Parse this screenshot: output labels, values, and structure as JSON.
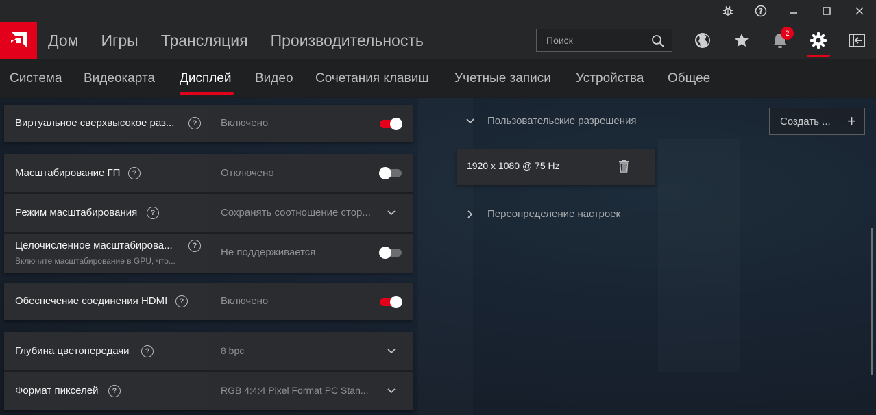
{
  "header": {
    "nav": [
      "Дом",
      "Игры",
      "Трансляция",
      "Производительность"
    ],
    "search_placeholder": "Поиск",
    "notification_count": "2"
  },
  "subnav": {
    "items": [
      "Система",
      "Видеокарта",
      "Дисплей",
      "Видео",
      "Сочетания клавиш",
      "Учетные записи",
      "Устройства",
      "Общее"
    ],
    "active": "Дисплей"
  },
  "settings": {
    "vsr": {
      "label": "Виртуальное сверхвысокое раз...",
      "value": "Включено",
      "enabled": true
    },
    "gpu_scaling": {
      "label": "Масштабирование ГП",
      "value": "Отключено",
      "enabled": false
    },
    "scaling_mode": {
      "label": "Режим масштабирования",
      "value": "Сохранять соотношение стор..."
    },
    "integer_scaling": {
      "label": "Целочисленное масштабирова...",
      "sublabel": "Включите масштабирование в GPU, что...",
      "value": "Не поддерживается",
      "enabled": false
    },
    "hdmi_link": {
      "label": "Обеспечение соединения HDMI",
      "value": "Включено",
      "enabled": true
    },
    "color_depth": {
      "label": "Глубина цветопередачи",
      "value": "8 bpc"
    },
    "pixel_format": {
      "label": "Формат пикселей",
      "value": "RGB 4:4:4 Pixel Format PC Stan..."
    }
  },
  "right": {
    "custom_res_title": "Пользовательские разрешения",
    "create_label": "Создать ...",
    "resolution": "1920 x 1080 @ 75 Hz",
    "override_title": "Переопределение настроек"
  },
  "colors": {
    "accent": "#e3001b"
  }
}
